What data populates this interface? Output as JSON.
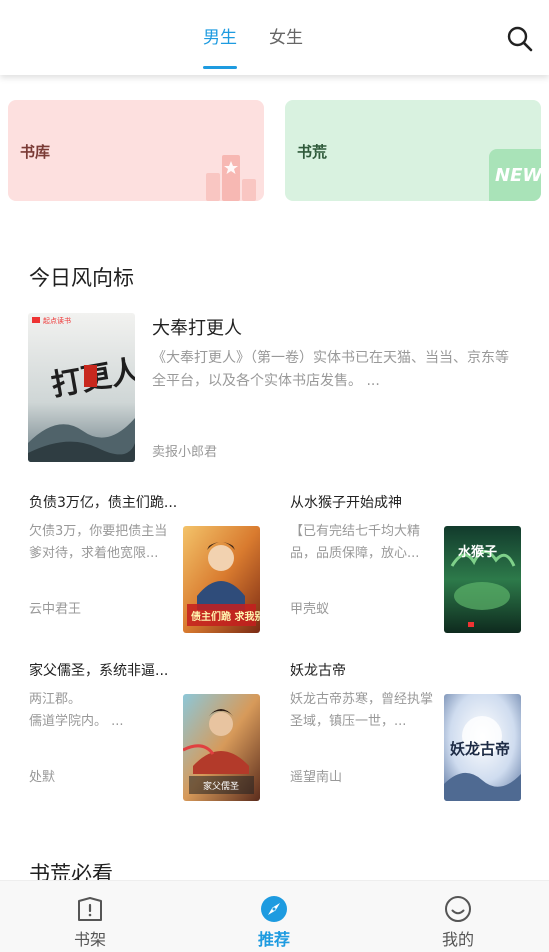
{
  "header": {
    "tabs": [
      {
        "label": "男生",
        "active": true
      },
      {
        "label": "女生",
        "active": false
      }
    ],
    "search_icon": "search-icon",
    "accent_color": "#1e9be0"
  },
  "cards": [
    {
      "label": "书库",
      "color": "#fde0df",
      "icon": "bookshelf-star-icon"
    },
    {
      "label": "书荒",
      "color": "#d9f2e0",
      "badge": "NEW"
    }
  ],
  "featured_section": {
    "title": "今日风向标",
    "featured": {
      "title": "大奉打更人",
      "description": "《大奉打更人》（第一卷）实体书已在天猫、当当、京东等全平台，以及各个实体书店发售。 ...",
      "author": "卖报小郎君",
      "cover_publisher": "起点读书",
      "cover_text": "打更人"
    },
    "items": [
      {
        "title": "负债3万亿，债主们跪...",
        "description": "欠债3万，你要把债主当爹对待，求着他宽限...",
        "author": "云中君王",
        "cover_text": "债主们跪 求我别死"
      },
      {
        "title": "从水猴子开始成神",
        "description": "【已有完结七千均大精品，品质保障，放心...",
        "author": "甲壳蚁",
        "cover_text": "水猴子"
      },
      {
        "title": "家父儒圣，系统非逼...",
        "description": "两江郡。\n儒道学院内。 ...",
        "author": "处默",
        "cover_text": "家父儒圣"
      },
      {
        "title": "妖龙古帝",
        "description": "妖龙古帝苏寒，曾经执掌圣域，镇压一世，...",
        "author": "遥望南山",
        "cover_text": "妖龙古帝"
      }
    ]
  },
  "second_section": {
    "title": "书荒必看"
  },
  "bottom_nav": [
    {
      "label": "书架",
      "icon": "bookshelf-icon",
      "active": false
    },
    {
      "label": "推荐",
      "icon": "compass-icon",
      "active": true
    },
    {
      "label": "我的",
      "icon": "smiley-profile-icon",
      "active": false
    }
  ]
}
